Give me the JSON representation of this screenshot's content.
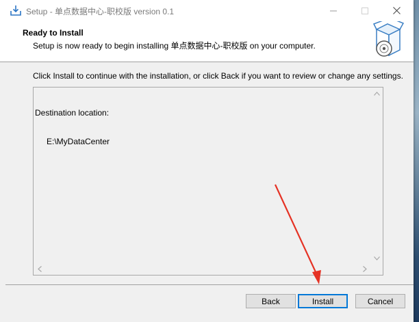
{
  "window": {
    "title": "Setup - 单点数据中心-职校版 version 0.1",
    "minimize_icon": "minimize-icon",
    "maximize_icon": "maximize-icon",
    "close_icon": "close-icon"
  },
  "header": {
    "title": "Ready to Install",
    "subtitle": "Setup is now ready to begin installing 单点数据中心-职校版 on your computer.",
    "image_icon": "install-box-icon"
  },
  "body": {
    "instruction": "Click Install to continue with the installation, or click Back if you want to review or change any settings."
  },
  "memo": {
    "label": "Destination location:",
    "value": "E:\\MyDataCenter"
  },
  "buttons": {
    "back": "Back",
    "install": "Install",
    "cancel": "Cancel"
  },
  "colors": {
    "default_button_border": "#0078d7",
    "annotation_arrow": "#e53224"
  }
}
